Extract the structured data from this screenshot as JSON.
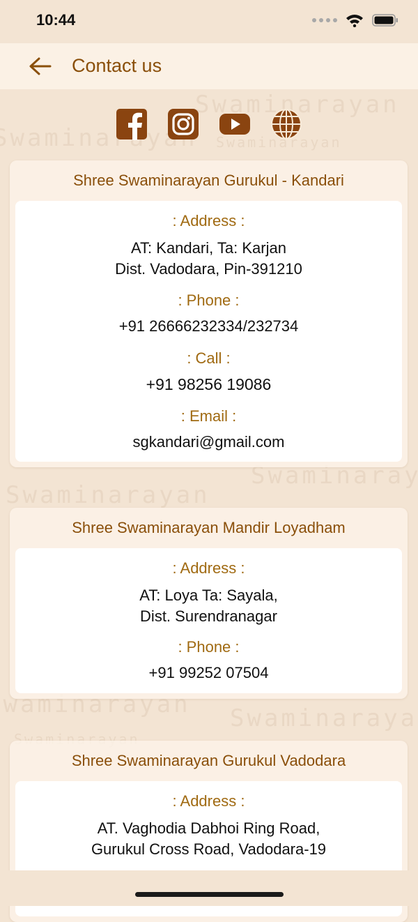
{
  "status_bar": {
    "time": "10:44"
  },
  "header": {
    "title": "Contact us"
  },
  "social": [
    {
      "icon": "facebook-icon"
    },
    {
      "icon": "instagram-icon"
    },
    {
      "icon": "youtube-icon"
    },
    {
      "icon": "globe-icon"
    }
  ],
  "watermark": "Swaminarayan",
  "labels": {
    "address": ": Address :",
    "phone": ": Phone :",
    "call": ": Call :",
    "email": ": Email :"
  },
  "contacts": [
    {
      "name": "Shree Swaminarayan Gurukul - Kandari",
      "address_line1": "AT: Kandari, Ta: Karjan",
      "address_line2": "Dist. Vadodara, Pin-391210",
      "phone": "+91 26666232334/232734",
      "call": "+91 98256 19086",
      "email": "sgkandari@gmail.com"
    },
    {
      "name": "Shree Swaminarayan Mandir Loyadham",
      "address_line1": "AT: Loya  Ta: Sayala,",
      "address_line2": "Dist. Surendranagar",
      "phone": "+91 99252 07504"
    },
    {
      "name": "Shree Swaminarayan Gurukul Vadodara",
      "address_line1": "AT. Vaghodia Dabhoi Ring Road,",
      "address_line2": "Gurukul Cross Road, Vadodara-19"
    }
  ],
  "colors": {
    "accent": "#8a4f0a",
    "label": "#a06a12",
    "icon": "#8a4410",
    "background": "#f3e4d3"
  }
}
